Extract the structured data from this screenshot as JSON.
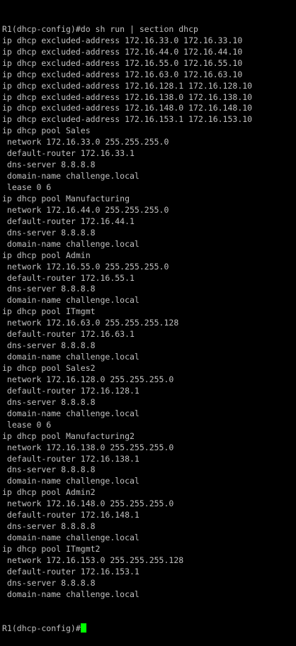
{
  "terminal": {
    "lines": [
      "R1(dhcp-config)#do sh run | section dhcp",
      "ip dhcp excluded-address 172.16.33.0 172.16.33.10",
      "ip dhcp excluded-address 172.16.44.0 172.16.44.10",
      "ip dhcp excluded-address 172.16.55.0 172.16.55.10",
      "ip dhcp excluded-address 172.16.63.0 172.16.63.10",
      "ip dhcp excluded-address 172.16.128.1 172.16.128.10",
      "ip dhcp excluded-address 172.16.138.0 172.16.138.10",
      "ip dhcp excluded-address 172.16.148.0 172.16.148.10",
      "ip dhcp excluded-address 172.16.153.1 172.16.153.10",
      "ip dhcp pool Sales",
      " network 172.16.33.0 255.255.255.0",
      " default-router 172.16.33.1",
      " dns-server 8.8.8.8",
      " domain-name challenge.local",
      " lease 0 6",
      "ip dhcp pool Manufacturing",
      " network 172.16.44.0 255.255.255.0",
      " default-router 172.16.44.1",
      " dns-server 8.8.8.8",
      " domain-name challenge.local",
      "ip dhcp pool Admin",
      " network 172.16.55.0 255.255.255.0",
      " default-router 172.16.55.1",
      " dns-server 8.8.8.8",
      " domain-name challenge.local",
      "ip dhcp pool ITmgmt",
      " network 172.16.63.0 255.255.255.128",
      " default-router 172.16.63.1",
      " dns-server 8.8.8.8",
      " domain-name challenge.local",
      "ip dhcp pool Sales2",
      " network 172.16.128.0 255.255.255.0",
      " default-router 172.16.128.1",
      " dns-server 8.8.8.8",
      " domain-name challenge.local",
      " lease 0 6",
      "ip dhcp pool Manufacturing2",
      " network 172.16.138.0 255.255.255.0",
      " default-router 172.16.138.1",
      " dns-server 8.8.8.8",
      " domain-name challenge.local",
      "ip dhcp pool Admin2",
      " network 172.16.148.0 255.255.255.0",
      " default-router 172.16.148.1",
      " dns-server 8.8.8.8",
      " domain-name challenge.local",
      "ip dhcp pool ITmgmt2",
      " network 172.16.153.0 255.255.255.128",
      " default-router 172.16.153.1",
      " dns-server 8.8.8.8",
      " domain-name challenge.local"
    ],
    "prompt": "R1(dhcp-config)#",
    "colors": {
      "background": "#000000",
      "text": "#c0c0c0",
      "cursor": "#00ff00"
    }
  }
}
